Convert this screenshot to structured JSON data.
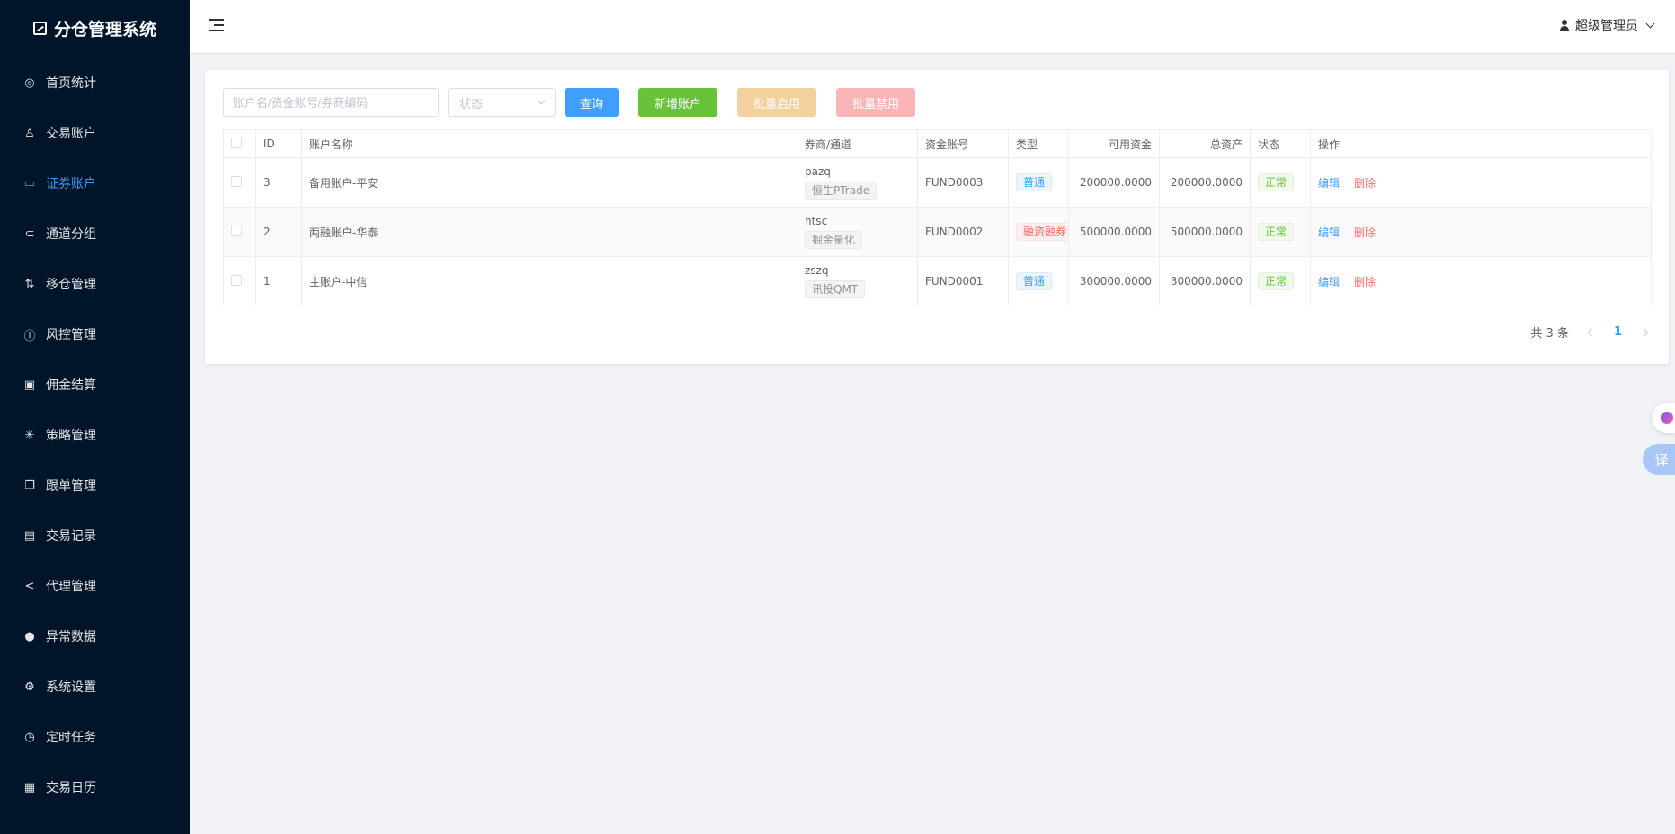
{
  "app": {
    "title": "分仓管理系统"
  },
  "sidebar": {
    "items": [
      {
        "label": "首页统计",
        "icon": "dashboard-icon",
        "glyph": "◎"
      },
      {
        "label": "交易账户",
        "icon": "user-icon",
        "glyph": "♙"
      },
      {
        "label": "证券账户",
        "icon": "folder-icon",
        "glyph": "▭",
        "active": true
      },
      {
        "label": "通道分组",
        "icon": "link-icon",
        "glyph": "⊂"
      },
      {
        "label": "移仓管理",
        "icon": "sort-icon",
        "glyph": "⇅"
      },
      {
        "label": "风控管理",
        "icon": "warning-icon",
        "glyph": "ⓘ"
      },
      {
        "label": "佣金结算",
        "icon": "wallet-icon",
        "glyph": "▣"
      },
      {
        "label": "策略管理",
        "icon": "loading-icon",
        "glyph": "✳"
      },
      {
        "label": "跟单管理",
        "icon": "copy-icon",
        "glyph": "❐"
      },
      {
        "label": "交易记录",
        "icon": "clipboard-icon",
        "glyph": "▤"
      },
      {
        "label": "代理管理",
        "icon": "share-icon",
        "glyph": "<"
      },
      {
        "label": "异常数据",
        "icon": "alert-icon",
        "glyph": "●"
      },
      {
        "label": "系统设置",
        "icon": "gear-icon",
        "glyph": "⚙"
      },
      {
        "label": "定时任务",
        "icon": "timer-icon",
        "glyph": "◷"
      },
      {
        "label": "交易日历",
        "icon": "calendar-icon",
        "glyph": "▦"
      }
    ]
  },
  "header": {
    "user_name": "超级管理员"
  },
  "toolbar": {
    "search_placeholder": "账户名/资金账号/券商编码",
    "status_placeholder": "状态",
    "query_label": "查询",
    "add_label": "新增账户",
    "enable_label": "批量启用",
    "disable_label": "批量禁用"
  },
  "colors": {
    "accent": "#409eff",
    "success": "#67c23a",
    "danger": "#f56c6c",
    "sidebar_bg": "#001529"
  },
  "table": {
    "headers": [
      "ID",
      "账户名称",
      "券商/通道",
      "资金账号",
      "类型",
      "可用资金",
      "总资产",
      "状态",
      "操作"
    ],
    "rows": [
      {
        "id": "3",
        "name": "备用账户-平安",
        "broker_code": "pazq",
        "channel": "恒生PTrade",
        "fund_account": "FUND0003",
        "type": "普通",
        "type_style": "blue",
        "available": "200000.0000",
        "total": "200000.0000",
        "status": "正常"
      },
      {
        "id": "2",
        "name": "两融账户-华泰",
        "broker_code": "htsc",
        "channel": "掘金量化",
        "fund_account": "FUND0002",
        "type": "融资融券",
        "type_style": "red",
        "type_overflow": "...",
        "available": "500000.0000",
        "total": "500000.0000",
        "status": "正常"
      },
      {
        "id": "1",
        "name": "主账户-中信",
        "broker_code": "zszq",
        "channel": "讯投QMT",
        "fund_account": "FUND0001",
        "type": "普通",
        "type_style": "blue",
        "available": "300000.0000",
        "total": "300000.0000",
        "status": "正常"
      }
    ],
    "edit_label": "编辑",
    "delete_label": "删除"
  },
  "pagination": {
    "total_text": "共 3 条",
    "current_page": "1"
  },
  "floating": {
    "translate_label": "译"
  }
}
